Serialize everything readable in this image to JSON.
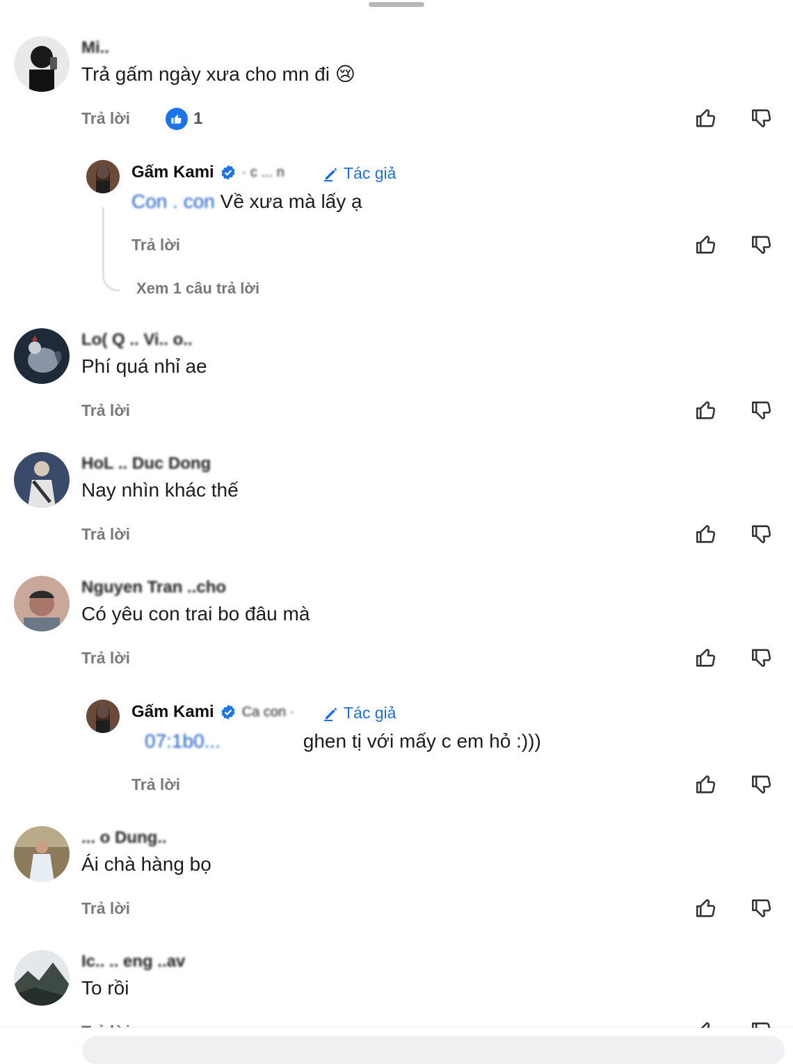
{
  "reply_label": "Trả lời",
  "comments": [
    {
      "name": "Mi..",
      "text": "Trả gấm ngày xưa cho mn đi 😢",
      "likes": "1"
    },
    {
      "name": "Gấm Kami",
      "tag": "· c ... n",
      "author_label": "Tác giả",
      "mention": "Con . con",
      "text": "Về xưa mà lấy ạ",
      "view_more": "Xem 1 câu trả lời"
    },
    {
      "name": "Lo( Q .. Vi.. o..",
      "text": "Phí quá nhỉ ae"
    },
    {
      "name": "HoL .. Duc Dong",
      "text": "Nay nhìn khác thế"
    },
    {
      "name": "Nguyen Tran ..cho",
      "text": "Có yêu con trai  bo đâu mà"
    },
    {
      "name": "Gấm Kami",
      "tag": "Ca  con ·",
      "author_label": "Tác giả",
      "mention": "07:1b0...",
      "text": "ghen tị với mấy c em hỏ :)))"
    },
    {
      "name": "... o Dung..",
      "text": "Ái chà hàng bọ"
    },
    {
      "name": "Ic.. .. eng  ..av",
      "text": "To rồi"
    }
  ],
  "colors": {
    "accent": "#1d6fe0",
    "like_blue": "#1d74e8",
    "muted": "#7a7a7a"
  }
}
